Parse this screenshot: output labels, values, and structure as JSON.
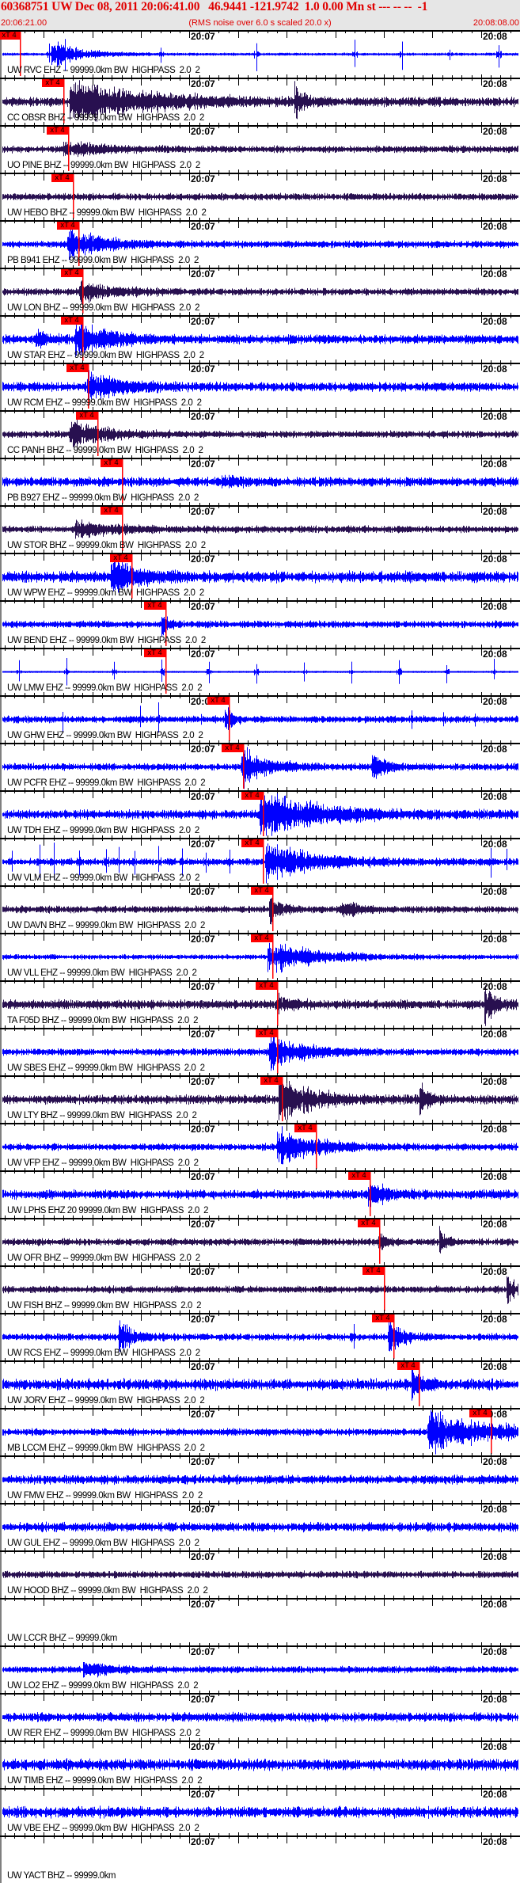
{
  "header": {
    "title": "60368751 UW Dec 08, 2011 20:06:41.00   46.9441 -121.9742  1.0 0.00 Mn st --- -- --  -1",
    "start_time": "20:06:21.00",
    "end_time": "20:08:08.00",
    "scale_note": "(RMS noise over 6.0 s scaled 20.0 x)"
  },
  "axis": {
    "minute_labels": [
      "20:07",
      "20:08"
    ]
  },
  "pick_label": "xT 4",
  "colors": {
    "header_text": "#e00000",
    "ehz_trace": "#0000ff",
    "bhz_trace": "#281050",
    "pick": "#ff0000",
    "header_bg": "#e6e6e6"
  },
  "stations": [
    {
      "label": "UW RVC EHZ -- 99999.0km BW  HIGHPASS  2.0  2",
      "pick": "20:06:25.1"
    },
    {
      "label": "CC OBSR BHZ -- 99999.0km BW  HIGHPASS  2.0  2",
      "pick": "20:06:34.0"
    },
    {
      "label": "UO PINE BHZ -- 99999.0km BW  HIGHPASS  2.0  2",
      "pick": "20:06:35.0"
    },
    {
      "label": "UW HEBO BHZ -- 99999.0km BW  HIGHPASS  2.0  2",
      "pick": "20:06:36.0"
    },
    {
      "label": "PB B941 EHZ -- 99999.0km BW  HIGHPASS  2.0  2",
      "pick": "20:06:37.1"
    },
    {
      "label": "UW LON BHZ -- 99999.0km BW  HIGHPASS  2.0  2",
      "pick": "20:06:37.9"
    },
    {
      "label": "UW STAR EHZ -- 99999.0km BW  HIGHPASS  2.0  2",
      "pick": "20:06:37.9"
    },
    {
      "label": "UW RCM EHZ -- 99999.0km BW  HIGHPASS  2.0  2",
      "pick": "20:06:39.1"
    },
    {
      "label": "CC PANH BHZ -- 99999.0km BW  HIGHPASS  2.0  2",
      "pick": "20:06:41.0"
    },
    {
      "label": "PB B927 EHZ -- 99999.0km BW  HIGHPASS  2.0  2",
      "pick": "20:06:46.1"
    },
    {
      "label": "UW STOR BHZ -- 99999.0km BW  HIGHPASS  2.0  2",
      "pick": "20:06:46.1"
    },
    {
      "label": "UW WPW EHZ -- 99999.0km BW  HIGHPASS  2.0  2",
      "pick": "20:06:48.0"
    },
    {
      "label": "UW BEND EHZ -- 99999.0km BW  HIGHPASS  2.0  2",
      "pick": "20:06:55.0"
    },
    {
      "label": "UW LMW EHZ -- 99999.0km BW  HIGHPASS  2.0  2",
      "pick": "20:06:55.0"
    },
    {
      "label": "UW GHW EHZ -- 99999.0km BW  HIGHPASS  2.0  2",
      "pick": "20:07:08.1"
    },
    {
      "label": "UW PCFR EHZ -- 99999.0km BW  HIGHPASS  2.0  2",
      "pick": "20:07:11.0"
    },
    {
      "label": "UW TDH EHZ -- 99999.0km BW  HIGHPASS  2.0  2",
      "pick": "20:07:15.1"
    },
    {
      "label": "UW VLM EHZ -- 99999.0km BW  HIGHPASS  2.0  2",
      "pick": "20:07:15.1"
    },
    {
      "label": "UW DAVN BHZ -- 99999.0km BW  HIGHPASS  2.0  2",
      "pick": "20:07:17.0"
    },
    {
      "label": "UW VLL EHZ -- 99999.0km BW  HIGHPASS  2.0  2",
      "pick": "20:07:17.0"
    },
    {
      "label": "TA F05D BHZ -- 99999.0km BW  HIGHPASS  2.0  2",
      "pick": "20:07:18.0"
    },
    {
      "label": "UW SBES EHZ -- 99999.0km BW  HIGHPASS  2.0  2",
      "pick": "20:07:18.0"
    },
    {
      "label": "UW LTY BHZ -- 99999.0km BW  HIGHPASS  2.0  2",
      "pick": "20:07:19.0"
    },
    {
      "label": "UW VFP EHZ -- 99999.0km BW  HIGHPASS  2.0  2",
      "pick": "20:07:26.0"
    },
    {
      "label": "UW LPHS EHZ 20 99999.0km BW  HIGHPASS  2.0  2",
      "pick": "20:07:37.1"
    },
    {
      "label": "UW OFR BHZ -- 99999.0km BW  HIGHPASS  2.0  2",
      "pick": "20:07:39.0"
    },
    {
      "label": "UW FISH BHZ -- 99999.0km BW  HIGHPASS  2.0  2",
      "pick": "20:07:40.0"
    },
    {
      "label": "UW RCS EHZ -- 99999.0km BW  HIGHPASS  2.0  2",
      "pick": "20:07:41.9"
    },
    {
      "label": "UW JORV EHZ -- 99999.0km BW  HIGHPASS  2.0  2",
      "pick": "20:07:47.2"
    },
    {
      "label": "MB LCCM EHZ -- 99999.0km BW  HIGHPASS  2.0  2",
      "pick": "20:08:02.0"
    },
    {
      "label": "UW FMW EHZ -- 99999.0km BW  HIGHPASS  2.0  2",
      "pick": null
    },
    {
      "label": "UW GUL EHZ -- 99999.0km BW  HIGHPASS  2.0  2",
      "pick": null
    },
    {
      "label": "UW HOOD BHZ -- 99999.0km BW  HIGHPASS  2.0  2",
      "pick": null
    },
    {
      "label": "UW LCCR BHZ -- 99999.0km",
      "pick": null
    },
    {
      "label": "UW LO2 EHZ -- 99999.0km BW  HIGHPASS  2.0  2",
      "pick": null
    },
    {
      "label": "UW RER EHZ -- 99999.0km BW  HIGHPASS  2.0  2",
      "pick": null
    },
    {
      "label": "UW TIMB EHZ -- 99999.0km BW  HIGHPASS  2.0  2",
      "pick": null
    },
    {
      "label": "UW VBE EHZ -- 99999.0km BW  HIGHPASS  2.0  2",
      "pick": null
    },
    {
      "label": "UW YACT BHZ -- 99999.0km",
      "pick": null
    }
  ]
}
